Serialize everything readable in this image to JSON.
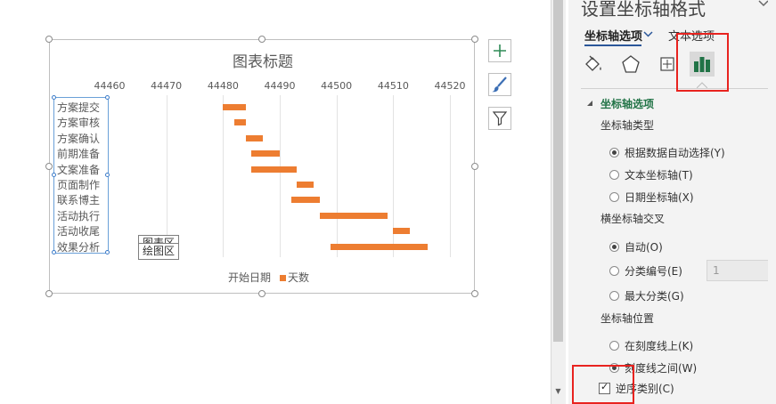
{
  "chart": {
    "title": "图表标题",
    "x_ticks": [
      "44460",
      "44470",
      "44480",
      "44490",
      "44500",
      "44510",
      "44520"
    ],
    "categories": [
      "方案提交",
      "方案审核",
      "方案确认",
      "前期准备",
      "文案准备",
      "页面制作",
      "联系博主",
      "活动执行",
      "活动收尾",
      "效果分析"
    ],
    "legend_start": "开始日期",
    "legend_days": "天数",
    "plot_area_label_hidden": "图表区",
    "plot_area_label": "绘图区",
    "bar_color": "#ed7d31"
  },
  "chart_data": {
    "type": "bar",
    "orientation": "horizontal",
    "title": "图表标题",
    "xlim": [
      44460,
      44520
    ],
    "categories": [
      "方案提交",
      "方案审核",
      "方案确认",
      "前期准备",
      "文案准备",
      "页面制作",
      "联系博主",
      "活动执行",
      "活动收尾",
      "效果分析"
    ],
    "series": [
      {
        "name": "开始日期",
        "values": [
          44480,
          44482,
          44484,
          44485,
          44485,
          44493,
          44492,
          44497,
          44510,
          44499
        ]
      },
      {
        "name": "天数",
        "values": [
          4,
          2,
          3,
          5,
          8,
          3,
          5,
          12,
          3,
          17
        ]
      }
    ],
    "legend": "bottom"
  },
  "side_buttons": [
    "plus-icon",
    "brush-icon",
    "filter-icon"
  ],
  "pane": {
    "title": "设置坐标轴格式",
    "tab_axis": "坐标轴选项",
    "tab_text": "文本选项",
    "section": "坐标轴选项",
    "axis_type_label": "坐标轴类型",
    "axis_type_options": [
      "根据数据自动选择(Y)",
      "文本坐标轴(T)",
      "日期坐标轴(X)"
    ],
    "cross_label": "横坐标轴交叉",
    "cross_options": [
      "自动(O)",
      "分类编号(E)",
      "最大分类(G)"
    ],
    "cross_value": "1",
    "position_label": "坐标轴位置",
    "position_options": [
      "在刻度线上(K)",
      "刻度线之间(W)"
    ],
    "reverse_label": "逆序类别(C)",
    "highlight_color": "#e8231f"
  }
}
